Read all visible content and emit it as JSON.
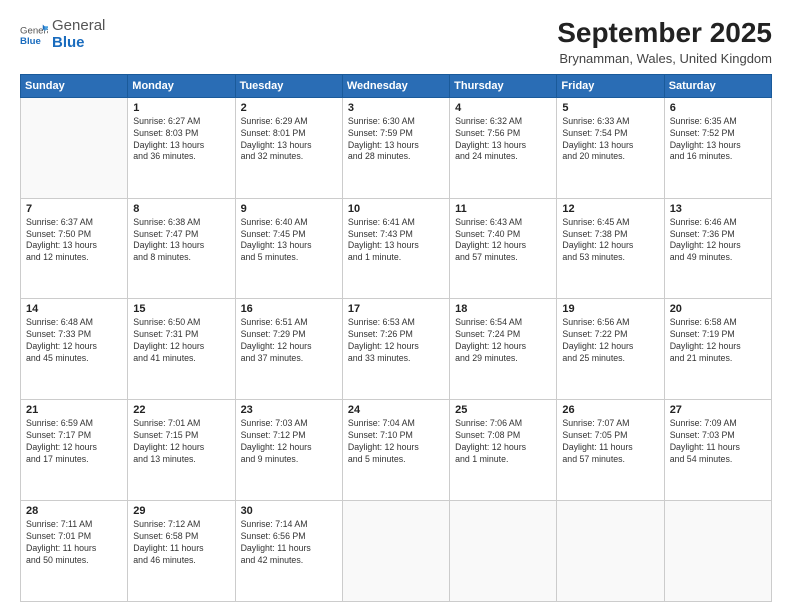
{
  "header": {
    "logo_general": "General",
    "logo_blue": "Blue",
    "month_title": "September 2025",
    "location": "Brynamman, Wales, United Kingdom"
  },
  "weekdays": [
    "Sunday",
    "Monday",
    "Tuesday",
    "Wednesday",
    "Thursday",
    "Friday",
    "Saturday"
  ],
  "weeks": [
    [
      {
        "day": "",
        "info": ""
      },
      {
        "day": "1",
        "info": "Sunrise: 6:27 AM\nSunset: 8:03 PM\nDaylight: 13 hours\nand 36 minutes."
      },
      {
        "day": "2",
        "info": "Sunrise: 6:29 AM\nSunset: 8:01 PM\nDaylight: 13 hours\nand 32 minutes."
      },
      {
        "day": "3",
        "info": "Sunrise: 6:30 AM\nSunset: 7:59 PM\nDaylight: 13 hours\nand 28 minutes."
      },
      {
        "day": "4",
        "info": "Sunrise: 6:32 AM\nSunset: 7:56 PM\nDaylight: 13 hours\nand 24 minutes."
      },
      {
        "day": "5",
        "info": "Sunrise: 6:33 AM\nSunset: 7:54 PM\nDaylight: 13 hours\nand 20 minutes."
      },
      {
        "day": "6",
        "info": "Sunrise: 6:35 AM\nSunset: 7:52 PM\nDaylight: 13 hours\nand 16 minutes."
      }
    ],
    [
      {
        "day": "7",
        "info": "Sunrise: 6:37 AM\nSunset: 7:50 PM\nDaylight: 13 hours\nand 12 minutes."
      },
      {
        "day": "8",
        "info": "Sunrise: 6:38 AM\nSunset: 7:47 PM\nDaylight: 13 hours\nand 8 minutes."
      },
      {
        "day": "9",
        "info": "Sunrise: 6:40 AM\nSunset: 7:45 PM\nDaylight: 13 hours\nand 5 minutes."
      },
      {
        "day": "10",
        "info": "Sunrise: 6:41 AM\nSunset: 7:43 PM\nDaylight: 13 hours\nand 1 minute."
      },
      {
        "day": "11",
        "info": "Sunrise: 6:43 AM\nSunset: 7:40 PM\nDaylight: 12 hours\nand 57 minutes."
      },
      {
        "day": "12",
        "info": "Sunrise: 6:45 AM\nSunset: 7:38 PM\nDaylight: 12 hours\nand 53 minutes."
      },
      {
        "day": "13",
        "info": "Sunrise: 6:46 AM\nSunset: 7:36 PM\nDaylight: 12 hours\nand 49 minutes."
      }
    ],
    [
      {
        "day": "14",
        "info": "Sunrise: 6:48 AM\nSunset: 7:33 PM\nDaylight: 12 hours\nand 45 minutes."
      },
      {
        "day": "15",
        "info": "Sunrise: 6:50 AM\nSunset: 7:31 PM\nDaylight: 12 hours\nand 41 minutes."
      },
      {
        "day": "16",
        "info": "Sunrise: 6:51 AM\nSunset: 7:29 PM\nDaylight: 12 hours\nand 37 minutes."
      },
      {
        "day": "17",
        "info": "Sunrise: 6:53 AM\nSunset: 7:26 PM\nDaylight: 12 hours\nand 33 minutes."
      },
      {
        "day": "18",
        "info": "Sunrise: 6:54 AM\nSunset: 7:24 PM\nDaylight: 12 hours\nand 29 minutes."
      },
      {
        "day": "19",
        "info": "Sunrise: 6:56 AM\nSunset: 7:22 PM\nDaylight: 12 hours\nand 25 minutes."
      },
      {
        "day": "20",
        "info": "Sunrise: 6:58 AM\nSunset: 7:19 PM\nDaylight: 12 hours\nand 21 minutes."
      }
    ],
    [
      {
        "day": "21",
        "info": "Sunrise: 6:59 AM\nSunset: 7:17 PM\nDaylight: 12 hours\nand 17 minutes."
      },
      {
        "day": "22",
        "info": "Sunrise: 7:01 AM\nSunset: 7:15 PM\nDaylight: 12 hours\nand 13 minutes."
      },
      {
        "day": "23",
        "info": "Sunrise: 7:03 AM\nSunset: 7:12 PM\nDaylight: 12 hours\nand 9 minutes."
      },
      {
        "day": "24",
        "info": "Sunrise: 7:04 AM\nSunset: 7:10 PM\nDaylight: 12 hours\nand 5 minutes."
      },
      {
        "day": "25",
        "info": "Sunrise: 7:06 AM\nSunset: 7:08 PM\nDaylight: 12 hours\nand 1 minute."
      },
      {
        "day": "26",
        "info": "Sunrise: 7:07 AM\nSunset: 7:05 PM\nDaylight: 11 hours\nand 57 minutes."
      },
      {
        "day": "27",
        "info": "Sunrise: 7:09 AM\nSunset: 7:03 PM\nDaylight: 11 hours\nand 54 minutes."
      }
    ],
    [
      {
        "day": "28",
        "info": "Sunrise: 7:11 AM\nSunset: 7:01 PM\nDaylight: 11 hours\nand 50 minutes."
      },
      {
        "day": "29",
        "info": "Sunrise: 7:12 AM\nSunset: 6:58 PM\nDaylight: 11 hours\nand 46 minutes."
      },
      {
        "day": "30",
        "info": "Sunrise: 7:14 AM\nSunset: 6:56 PM\nDaylight: 11 hours\nand 42 minutes."
      },
      {
        "day": "",
        "info": ""
      },
      {
        "day": "",
        "info": ""
      },
      {
        "day": "",
        "info": ""
      },
      {
        "day": "",
        "info": ""
      }
    ]
  ]
}
